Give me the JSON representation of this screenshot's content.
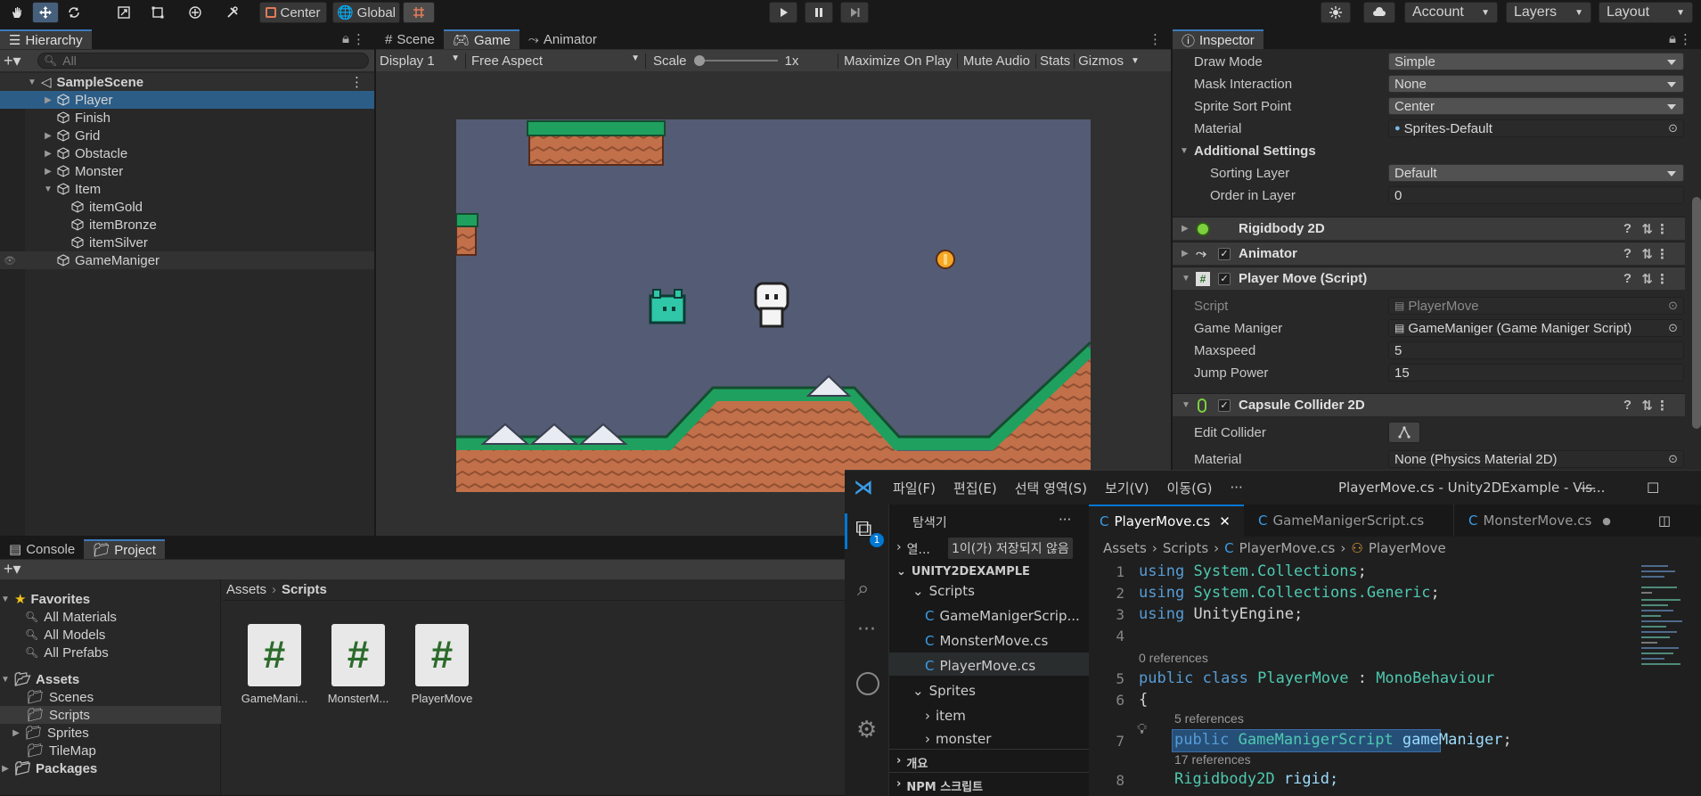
{
  "toolbar": {
    "center_label": "Center",
    "global_label": "Global",
    "account_label": "Account",
    "layers_label": "Layers",
    "layout_label": "Layout"
  },
  "hierarchy": {
    "tab_label": "Hierarchy",
    "search_placeholder": "All",
    "scene_name": "SampleScene",
    "items": [
      "Player",
      "Finish",
      "Grid",
      "Obstacle",
      "Monster",
      "Item",
      "itemGold",
      "itemBronze",
      "itemSilver",
      "GameManiger"
    ]
  },
  "game_view": {
    "tabs": [
      "Scene",
      "Game",
      "Animator"
    ],
    "display": "Display 1",
    "aspect": "Free Aspect",
    "scale_label": "Scale",
    "scale_value": "1x",
    "buttons": [
      "Maximize On Play",
      "Mute Audio",
      "Stats",
      "Gizmos"
    ]
  },
  "inspector": {
    "tab_label": "Inspector",
    "draw_mode_label": "Draw Mode",
    "draw_mode_value": "Simple",
    "mask_label": "Mask Interaction",
    "mask_value": "None",
    "sort_point_label": "Sprite Sort Point",
    "sort_point_value": "Center",
    "material_label": "Material",
    "material_value": "Sprites-Default",
    "additional_label": "Additional Settings",
    "sorting_layer_label": "Sorting Layer",
    "sorting_layer_value": "Default",
    "order_label": "Order in Layer",
    "order_value": "0",
    "rigidbody_label": "Rigidbody 2D",
    "animator_label": "Animator",
    "playermove_label": "Player Move (Script)",
    "script_label": "Script",
    "script_value": "PlayerMove",
    "gm_label": "Game Maniger",
    "gm_value": "GameManiger (Game Maniger Script)",
    "maxspeed_label": "Maxspeed",
    "maxspeed_value": "5",
    "jump_label": "Jump Power",
    "jump_value": "15",
    "capsule_label": "Capsule Collider 2D",
    "edit_collider_label": "Edit Collider",
    "phys_material_label": "Material",
    "phys_material_value": "None (Physics Material 2D)"
  },
  "bottom": {
    "tabs": [
      "Console",
      "Project"
    ],
    "favorites_label": "Favorites",
    "favorites": [
      "All Materials",
      "All Models",
      "All Prefabs"
    ],
    "assets_label": "Assets",
    "assets": [
      "Scenes",
      "Scripts",
      "Sprites",
      "TileMap"
    ],
    "packages_label": "Packages",
    "breadcrumb": [
      "Assets",
      "Scripts"
    ],
    "files": [
      "GameMani...",
      "MonsterM...",
      "PlayerMove"
    ]
  },
  "vscode": {
    "menus": [
      "파일(F)",
      "편집(E)",
      "선택 영역(S)",
      "보기(V)",
      "이동(G)",
      "···"
    ],
    "title": "PlayerMove.cs - Unity2DExample - Vis...",
    "explorer_label": "탐색기",
    "open_editors_label": "열...",
    "unsaved_label": "1이(가) 저장되지 않음",
    "badge": "1",
    "project_label": "UNITY2DEXAMPLE",
    "tree": [
      "Scripts",
      "GameManigerScrip...",
      "MonsterMove.cs",
      "PlayerMove.cs",
      "Sprites",
      "item",
      "monster"
    ],
    "outline_label": "개요",
    "npm_label": "NPM 스크립트",
    "tabs": [
      "PlayerMove.cs",
      "GameManigerScript.cs",
      "MonsterMove.cs"
    ],
    "breadcrumb": [
      "Assets",
      "Scripts",
      "PlayerMove.cs",
      "PlayerMove"
    ],
    "line_numbers": [
      "1",
      "2",
      "3",
      "4",
      "5",
      "6",
      "7",
      "8"
    ],
    "lens_0": "0 references",
    "lens_5": "5 references",
    "lens_17": "17 references",
    "code": {
      "using": "using",
      "ns1": "System.Collections",
      "ns2": "System.Collections.Generic",
      "ns3": "UnityEngine",
      "public": "public",
      "class": "class",
      "classname": "PlayerMove",
      "colon": " : ",
      "base": "MonoBehaviour",
      "brace": "{",
      "gms": "GameManigerScript",
      "gmvar": "gameManiger",
      "rb": "Rigidbody2D",
      "rbvar": "rigid;"
    }
  }
}
